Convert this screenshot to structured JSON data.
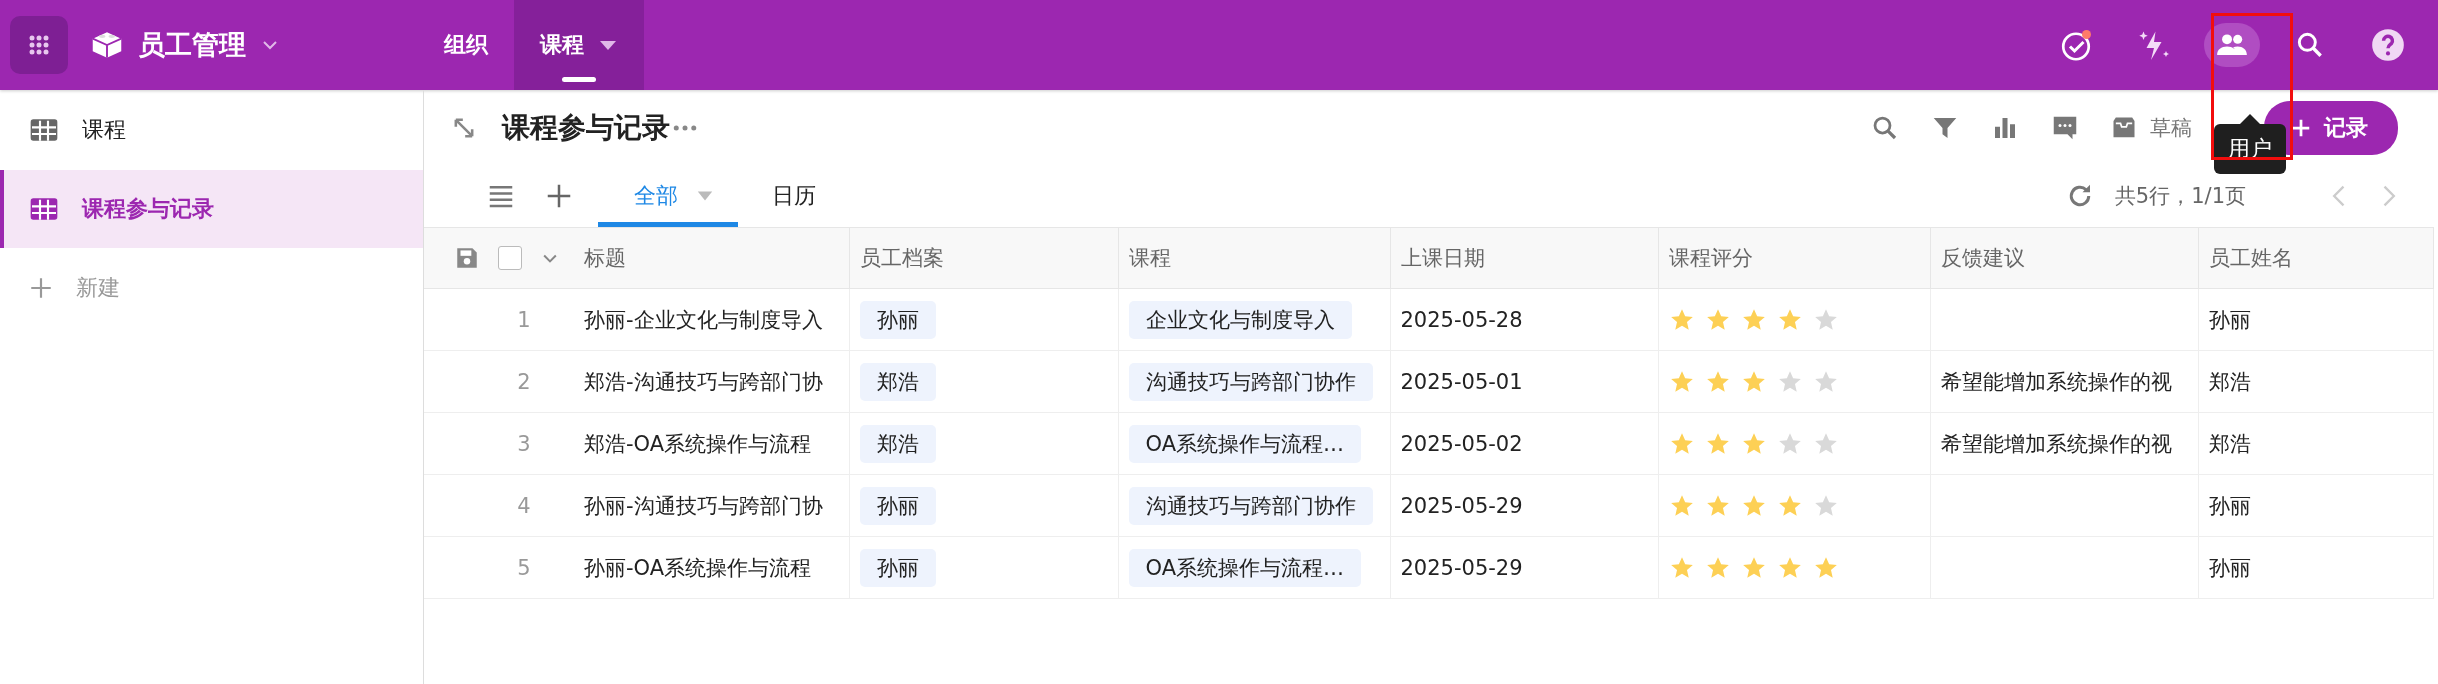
{
  "app_bar": {
    "app_name": "员工管理",
    "tabs": [
      {
        "label": "组织",
        "selected": false
      },
      {
        "label": "课程",
        "selected": true
      }
    ],
    "tooltip": "用户"
  },
  "sidebar": {
    "items": [
      {
        "label": "课程",
        "selected": false
      },
      {
        "label": "课程参与记录",
        "selected": true
      }
    ],
    "new_label": "新建"
  },
  "page": {
    "title": "课程参与记录",
    "drafts_label": "草稿",
    "add_button": "记录",
    "views": [
      {
        "label": "全部",
        "selected": true
      },
      {
        "label": "日历",
        "selected": false
      }
    ],
    "pagination": "共5行，1/1页"
  },
  "table": {
    "select_all_checked": false,
    "columns": [
      "标题",
      "员工档案",
      "课程",
      "上课日期",
      "课程评分",
      "反馈建议",
      "员工姓名"
    ],
    "rows": [
      {
        "index": "1",
        "title": "孙丽-企业文化与制度导入",
        "employee": "孙丽",
        "course": "企业文化与制度导入",
        "date": "2025-05-28",
        "stars": 4,
        "name": "孙丽"
      },
      {
        "index": "2",
        "title": "郑浩-沟通技巧与跨部门协",
        "employee": "郑浩",
        "course": "沟通技巧与跨部门协作",
        "date": "2025-05-01",
        "stars": 3,
        "feedback": "希望能增加系统操作的视",
        "name": "郑浩"
      },
      {
        "index": "3",
        "title": "郑浩-OA系统操作与流程",
        "employee": "郑浩",
        "course": "OA系统操作与流程…",
        "date": "2025-05-02",
        "stars": 3,
        "feedback": "希望能增加系统操作的视",
        "name": "郑浩"
      },
      {
        "index": "4",
        "title": "孙丽-沟通技巧与跨部门协",
        "employee": "孙丽",
        "course": "沟通技巧与跨部门协作",
        "date": "2025-05-29",
        "stars": 4,
        "name": "孙丽"
      },
      {
        "index": "5",
        "title": "孙丽-OA系统操作与流程",
        "employee": "孙丽",
        "course": "OA系统操作与流程…",
        "date": "2025-05-29",
        "stars": 5,
        "name": "孙丽"
      }
    ]
  }
}
